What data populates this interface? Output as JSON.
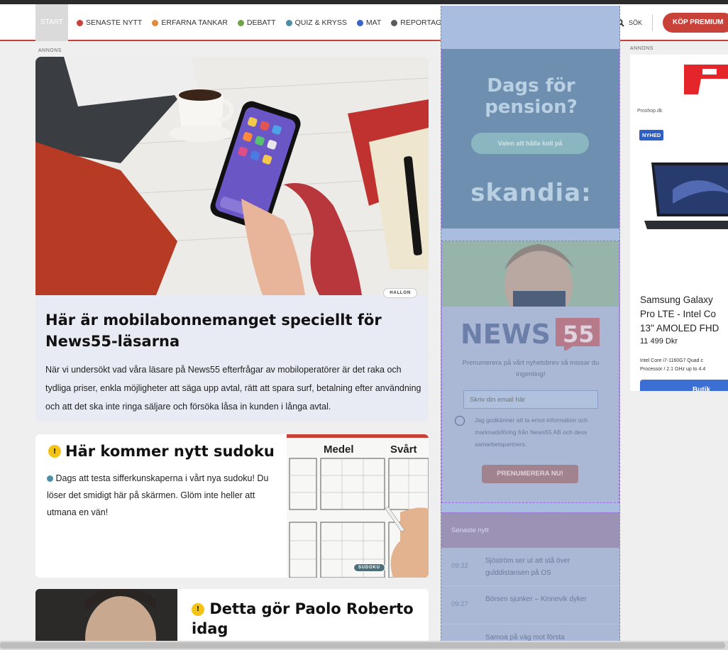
{
  "nav": {
    "start": "START",
    "items": [
      {
        "label": "SENASTE NYTT",
        "color": "#c9423a"
      },
      {
        "label": "ERFARNA TANKAR",
        "color": "#e08a3a"
      },
      {
        "label": "DEBATT",
        "color": "#6fa34a"
      },
      {
        "label": "QUIZ & KRYSS",
        "color": "#4e8fa8"
      },
      {
        "label": "MAT",
        "color": "#3a63c7"
      },
      {
        "label": "REPORTAGE",
        "color": "#5a5a5a"
      }
    ],
    "search": "SÖK",
    "premium": "KÖP PREMIUM"
  },
  "ads": {
    "annons_left": "ANNONS",
    "annons_right": "ANNONS"
  },
  "article1": {
    "badge": "HALLON",
    "title": "Här är mobilabonnemanget speciellt för News55-läsarna",
    "text": "När vi undersökt vad våra läsare på News55 efterfrågar av mobiloperatörer är det raka och tydliga priser, enkla möjligheter att säga upp avtal, rätt att spara surf, betalning efter användning och att det ska inte ringa säljare och försöka låsa in kunden i långa avtal."
  },
  "article2": {
    "title": "Här kommer nytt sudoku",
    "text": "Dags att testa sifferkunskaperna i vårt nya sudoku! Du löser det smidigt här på skärmen. Glöm inte heller att utmana en vän!",
    "img_label_1": "Medel",
    "img_label_2": "Svårt",
    "badge": "SUDOKU"
  },
  "article3": {
    "title": "Detta gör Paolo Roberto idag"
  },
  "skandia": {
    "heading_1": "Dags för",
    "heading_2": "pension?",
    "button": "Valen att hålla koll på",
    "logo": "skandia"
  },
  "newsletter": {
    "logo_left": "NEWS",
    "logo_right": "55",
    "description": "Prenumerera på vårt nyhetsbrev så missar du ingenting!",
    "email_placeholder": "Skriv din email här",
    "consent": "Jag godkänner att ta emot information och marknadsföring från News55 AB och dess samarbetspartners.",
    "subscribe": "PRENUMERERA NU!"
  },
  "latest": {
    "header": "Senaste nytt",
    "items": [
      {
        "time": "09:32",
        "headline": "Sjöström ser ut att stå över gulddistansen på OS"
      },
      {
        "time": "09:27",
        "headline": "Börsen sjunker – Kinnevik dyker"
      },
      {
        "time": "",
        "headline": "Samoa på väg mot första"
      }
    ]
  },
  "right_ad": {
    "source": "Proshop.dk",
    "badge": "NYHED",
    "product_line1": "Samsung Galaxy",
    "product_line2": "Pro LTE - Intel Co",
    "product_line3": "13\" AMOLED FHD",
    "price": "11 499 Dkr",
    "spec_line1": "Intel Core i7-1160G7 Quad c",
    "spec_line2": "Processor / 2.1 GHz up to 4.4",
    "button": "Butik"
  }
}
